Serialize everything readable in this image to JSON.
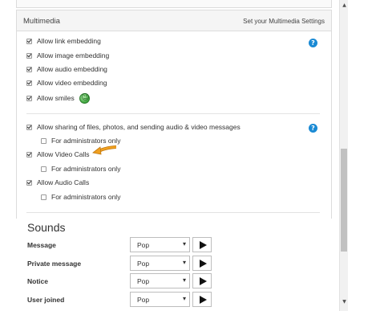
{
  "multimedia": {
    "title": "Multimedia",
    "settings_link": "Set your Multimedia Settings",
    "embedding": [
      {
        "label": "Allow link embedding",
        "checked": true
      },
      {
        "label": "Allow image embedding",
        "checked": true
      },
      {
        "label": "Allow audio embedding",
        "checked": true
      },
      {
        "label": "Allow video embedding",
        "checked": true
      },
      {
        "label": "Allow smiles",
        "checked": true
      }
    ],
    "sharing": {
      "label": "Allow sharing of files, photos, and sending audio & video messages",
      "checked": true
    },
    "sharing_admins": {
      "label": "For administrators only",
      "checked": false
    },
    "video_calls": {
      "label": "Allow Video Calls",
      "checked": true
    },
    "video_admins": {
      "label": "For administrators only",
      "checked": false
    },
    "audio_calls": {
      "label": "Allow Audio Calls",
      "checked": true
    },
    "audio_admins": {
      "label": "For administrators only",
      "checked": false
    },
    "help_symbol": "?"
  },
  "sounds": {
    "title": "Sounds",
    "rows": [
      {
        "label": "Message",
        "value": "Pop"
      },
      {
        "label": "Private message",
        "value": "Pop"
      },
      {
        "label": "Notice",
        "value": "Pop"
      },
      {
        "label": "User joined",
        "value": "Pop"
      }
    ]
  },
  "colors": {
    "help_icon": "#1a8ad4",
    "arrow": "#f0a020",
    "smile": "#3ba33b"
  }
}
